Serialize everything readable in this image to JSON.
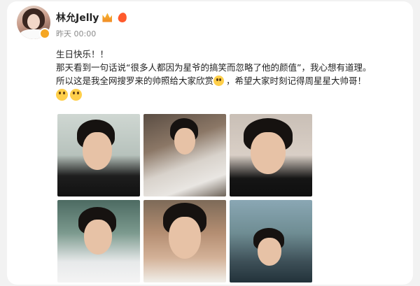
{
  "user": {
    "name": "林允Jelly",
    "post_time": "昨天 00:00"
  },
  "post": {
    "lines": [
      "生日快乐！！",
      "那天看到一句话说“很多人都因为星爷的搞笑而忽略了他的颜值”，我心想有道理。",
      "所以这是我全网搜罗来的帅照给大家欣赏",
      "，希望大家时刻记得周星星大帅哥！"
    ]
  },
  "photos": [
    {
      "name": "photo-1"
    },
    {
      "name": "photo-2"
    },
    {
      "name": "photo-3"
    },
    {
      "name": "photo-4"
    },
    {
      "name": "photo-5"
    },
    {
      "name": "photo-6"
    }
  ],
  "icons": [
    "crown-icon",
    "flame-icon",
    "verified-badge-icon",
    "grin-emoji-icon",
    "shy-emoji-icon"
  ],
  "colors": {
    "background": "#f2f2f2",
    "card": "#ffffff",
    "text": "#1f1f1f",
    "muted": "#8a8a8a",
    "badge": "#f5a623"
  }
}
